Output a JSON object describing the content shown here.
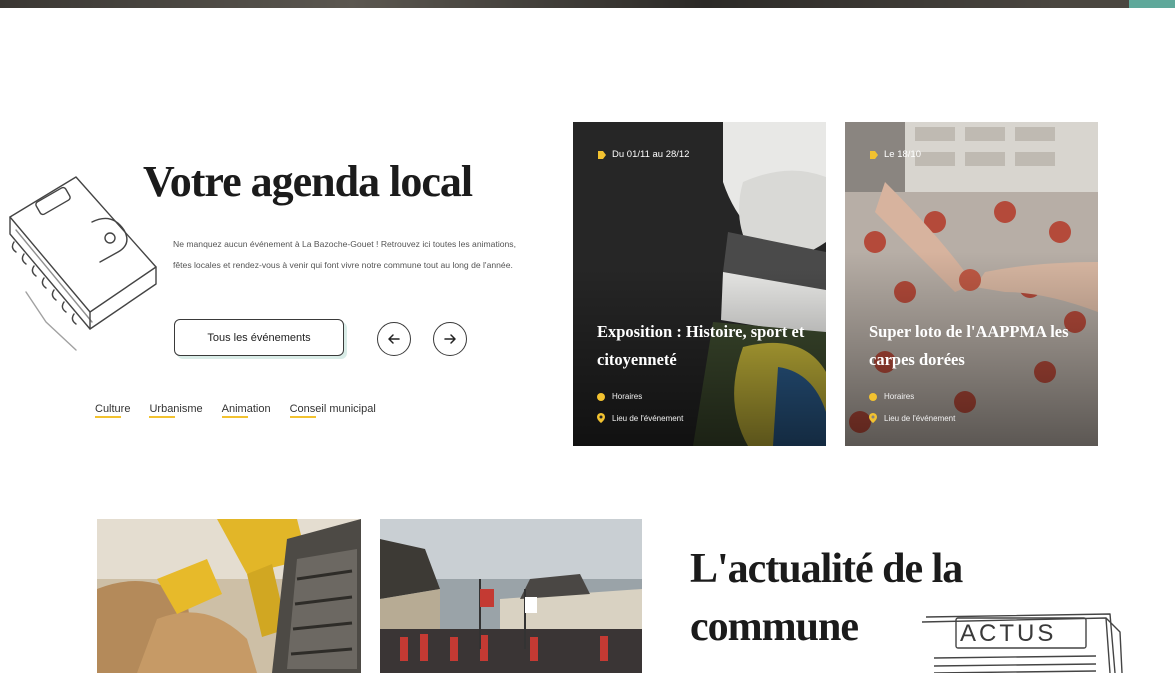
{
  "agenda": {
    "title": "Votre agenda local",
    "description": "Ne manquez aucun événement à La Bazoche-Gouet ! Retrouvez ici toutes les animations, fêtes locales et rendez-vous à venir qui font vivre notre commune tout au long de l'année.",
    "all_events_label": "Tous les événements",
    "prev_icon": "arrow-left-icon",
    "next_icon": "arrow-right-icon",
    "tags": [
      "Culture",
      "Urbanisme",
      "Animation",
      "Conseil municipal"
    ]
  },
  "events": [
    {
      "date": "Du 01/11 au 28/12",
      "title": "Exposition : Histoire, sport et citoyenneté",
      "hours": "Horaires",
      "place": "Lieu de l'événement"
    },
    {
      "date": "Le 18/10",
      "title": "Super loto de l'AAPPMA les carpes dorées",
      "hours": "Horaires",
      "place": "Lieu de l'événement"
    }
  ],
  "news": {
    "title": "L'actualité de la commune",
    "badge": "ACTUS"
  },
  "colors": {
    "accent_yellow": "#f2c230",
    "accent_teal": "#5fa89a",
    "text_dark": "#1b1b1b"
  }
}
